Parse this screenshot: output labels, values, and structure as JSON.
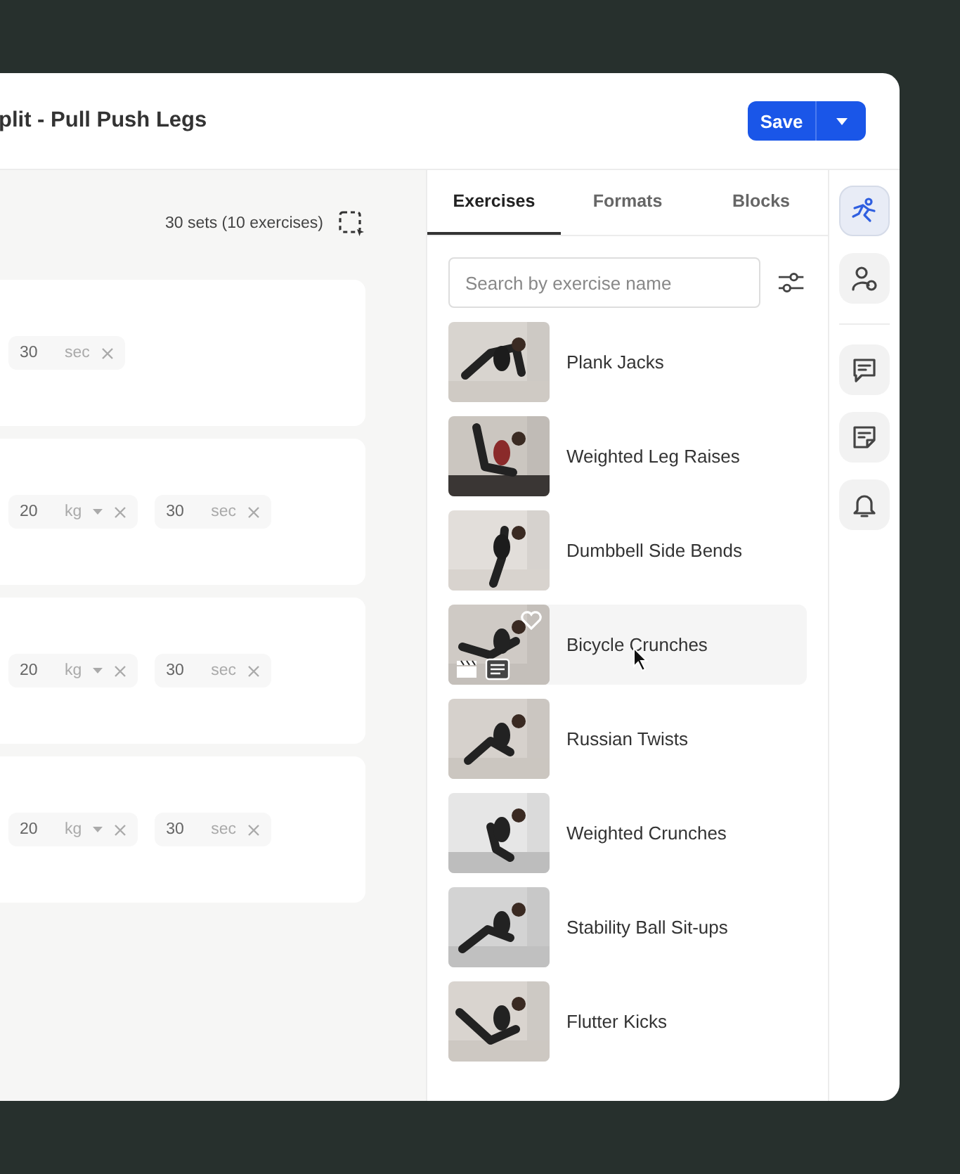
{
  "window": {
    "title": "plit -  Pull Push Legs"
  },
  "save_button": {
    "label": "Save"
  },
  "summary": "30 sets (10 exercises)",
  "cards": [
    {
      "chips": [
        {
          "value": "30",
          "unit": "sec",
          "dropdown": false
        }
      ]
    },
    {
      "chips": [
        {
          "value": "20",
          "unit": "kg",
          "dropdown": true
        },
        {
          "value": "30",
          "unit": "sec",
          "dropdown": false
        }
      ]
    },
    {
      "chips": [
        {
          "value": "20",
          "unit": "kg",
          "dropdown": true
        },
        {
          "value": "30",
          "unit": "sec",
          "dropdown": false
        }
      ]
    },
    {
      "chips": [
        {
          "value": "20",
          "unit": "kg",
          "dropdown": true
        },
        {
          "value": "30",
          "unit": "sec",
          "dropdown": false
        }
      ]
    }
  ],
  "tabs": [
    {
      "label": "Exercises",
      "selected": true
    },
    {
      "label": "Formats",
      "selected": false
    },
    {
      "label": "Blocks",
      "selected": false
    }
  ],
  "search": {
    "placeholder": "Search by exercise name"
  },
  "exercises": [
    {
      "name": "Plank Jacks",
      "hovered": false
    },
    {
      "name": "Weighted Leg Raises",
      "hovered": false
    },
    {
      "name": "Dumbbell Side Bends",
      "hovered": false
    },
    {
      "name": "Bicycle Crunches",
      "hovered": true
    },
    {
      "name": "Russian Twists",
      "hovered": false
    },
    {
      "name": "Weighted Crunches",
      "hovered": false
    },
    {
      "name": "Stability Ball Sit-ups",
      "hovered": false
    },
    {
      "name": "Flutter Kicks",
      "hovered": false
    }
  ],
  "rail": [
    {
      "kind": "exercise",
      "selected": true
    },
    {
      "kind": "client",
      "selected": false
    },
    {
      "kind": "chat",
      "selected": false
    },
    {
      "kind": "note",
      "selected": false
    },
    {
      "kind": "bell",
      "selected": false
    }
  ]
}
